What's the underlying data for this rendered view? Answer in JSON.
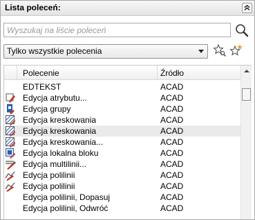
{
  "panel": {
    "title": "Lista poleceń:"
  },
  "search": {
    "placeholder": "Wyszukaj na liście poleceń"
  },
  "filter": {
    "selected": "Tylko wszystkie polecenia"
  },
  "table": {
    "columns": {
      "command": "Polecenie",
      "source": "Źródło"
    },
    "rows": [
      {
        "name": "EDTEKST",
        "source": "ACAD",
        "icon": "none"
      },
      {
        "name": "Edycja atrybutu...",
        "source": "ACAD",
        "icon": "edit-attribute-icon"
      },
      {
        "name": "Edycja grupy",
        "source": "ACAD",
        "icon": "edit-group-icon"
      },
      {
        "name": "Edycja kreskowania",
        "source": "ACAD",
        "icon": "edit-hatch-icon"
      },
      {
        "name": "Edycja kreskowania",
        "source": "ACAD",
        "icon": "edit-hatch-icon"
      },
      {
        "name": "Edycja kreskowania...",
        "source": "ACAD",
        "icon": "edit-hatch-icon"
      },
      {
        "name": "Edycja lokalna bloku",
        "source": "ACAD",
        "icon": "edit-block-icon"
      },
      {
        "name": "Edycja multilinii...",
        "source": "ACAD",
        "icon": "edit-multiline-icon"
      },
      {
        "name": "Edycja polilinii",
        "source": "ACAD",
        "icon": "edit-polyline-icon"
      },
      {
        "name": "Edycja polilinii",
        "source": "ACAD",
        "icon": "edit-polyline-icon"
      },
      {
        "name": "Edycja polilinii, Dopasuj",
        "source": "ACAD",
        "icon": "none"
      },
      {
        "name": "Edycja polilinii, Odwróć",
        "source": "ACAD",
        "icon": "none"
      }
    ]
  },
  "colors": {
    "selected_row": "#eaeaea",
    "icon_red": "#c0392b",
    "icon_blue": "#2d5fa8"
  }
}
